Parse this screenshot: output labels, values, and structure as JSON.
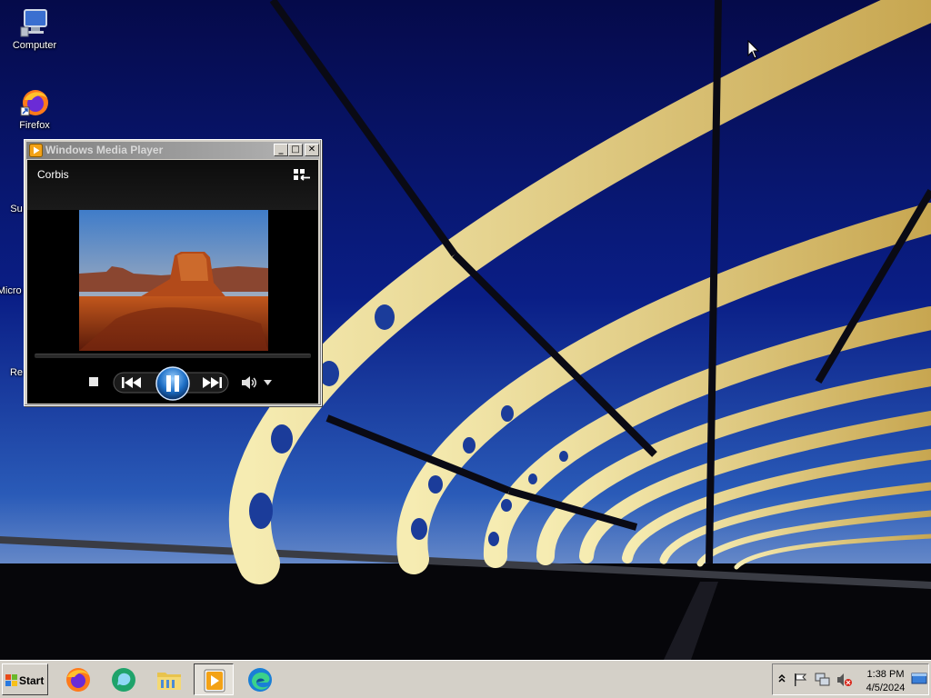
{
  "desktop": {
    "icons": [
      {
        "label": "Computer",
        "icon": "computer-icon"
      },
      {
        "label": "Firefox",
        "icon": "firefox-icon"
      },
      {
        "label": "Su",
        "icon": "support-icon"
      },
      {
        "label": "Micro Stu",
        "icon": "visual-studio-icon"
      },
      {
        "label": "Re",
        "icon": "recycle-bin-icon"
      }
    ]
  },
  "wmp": {
    "window_title": "Windows Media Player",
    "media_title": "Corbis",
    "state": "playing",
    "title_buttons": {
      "minimize": "_",
      "maximize": "□",
      "close": "✕"
    },
    "controls": [
      "stop",
      "previous",
      "pause",
      "next",
      "mute",
      "volume-dropdown"
    ]
  },
  "taskbar": {
    "start_label": "Start",
    "apps": [
      {
        "name": "firefox",
        "icon": "firefox-icon",
        "active": false
      },
      {
        "name": "skype-like",
        "icon": "chat-icon",
        "active": false
      },
      {
        "name": "explorer",
        "icon": "folder-icon",
        "active": false
      },
      {
        "name": "wmp",
        "icon": "media-player-icon",
        "active": true
      },
      {
        "name": "edge",
        "icon": "edge-icon",
        "active": false
      }
    ],
    "tray": {
      "icons": [
        "show-hidden-icon",
        "flag-icon",
        "network-icon",
        "volume-muted-icon"
      ],
      "time": "1:38 PM",
      "date": "4/5/2024"
    }
  }
}
